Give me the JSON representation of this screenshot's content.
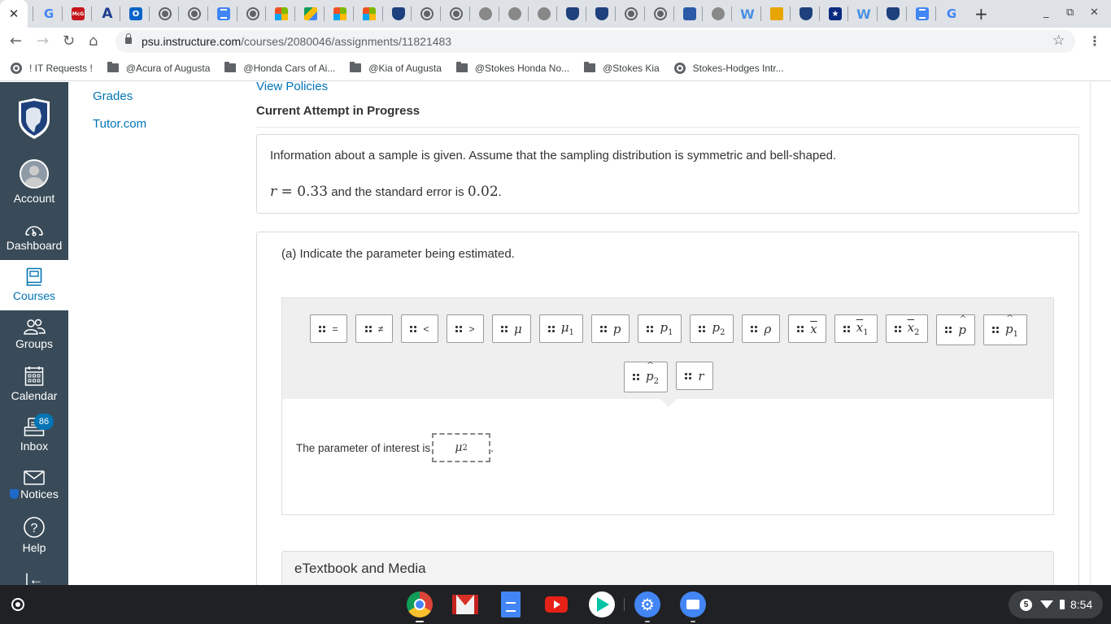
{
  "browser": {
    "active_tab_close": "✕",
    "pinned_tabs": [
      {
        "icon": "google-icon",
        "glyph": "G",
        "cls": "g"
      },
      {
        "icon": "mcgraw-hill-icon",
        "glyph": "McG",
        "cls": "mcg"
      },
      {
        "icon": "aleks-icon",
        "glyph": "A",
        "cls": "a"
      },
      {
        "icon": "outlook-icon",
        "glyph": "O",
        "cls": "outlook"
      },
      {
        "icon": "globe-icon",
        "glyph": "",
        "cls": "globe"
      },
      {
        "icon": "globe-icon",
        "glyph": "",
        "cls": "globe"
      },
      {
        "icon": "google-docs-icon",
        "glyph": "",
        "cls": "docs"
      },
      {
        "icon": "globe-icon",
        "glyph": "",
        "cls": "globe"
      },
      {
        "icon": "microsoft-icon",
        "glyph": "",
        "cls": "ms"
      },
      {
        "icon": "google-drive-icon",
        "glyph": "",
        "cls": "drive"
      },
      {
        "icon": "microsoft-icon",
        "glyph": "",
        "cls": "ms"
      },
      {
        "icon": "microsoft-icon",
        "glyph": "",
        "cls": "ms"
      },
      {
        "icon": "psu-shield-icon",
        "glyph": "",
        "cls": "psu"
      },
      {
        "icon": "globe-icon",
        "glyph": "",
        "cls": "globe"
      },
      {
        "icon": "globe-icon",
        "glyph": "",
        "cls": "globe"
      },
      {
        "icon": "seal-icon",
        "glyph": "",
        "cls": "seal"
      },
      {
        "icon": "seal-icon",
        "glyph": "",
        "cls": "seal"
      },
      {
        "icon": "seal-icon",
        "glyph": "",
        "cls": "seal"
      },
      {
        "icon": "psu-shield-icon",
        "glyph": "",
        "cls": "psu"
      },
      {
        "icon": "psu-shield-icon",
        "glyph": "",
        "cls": "psu"
      },
      {
        "icon": "globe-icon",
        "glyph": "",
        "cls": "globe"
      },
      {
        "icon": "globe-icon",
        "glyph": "",
        "cls": "globe"
      },
      {
        "icon": "irs-icon",
        "glyph": "",
        "cls": "irs"
      },
      {
        "icon": "seal-icon",
        "glyph": "",
        "cls": "seal"
      },
      {
        "icon": "word-icon",
        "glyph": "W",
        "cls": "w"
      },
      {
        "icon": "lock-icon",
        "glyph": "",
        "cls": "lock"
      },
      {
        "icon": "psu-shield-icon",
        "glyph": "",
        "cls": "psu"
      },
      {
        "icon": "star-shield-icon",
        "glyph": "★",
        "cls": "star"
      },
      {
        "icon": "word-icon",
        "glyph": "W",
        "cls": "w"
      },
      {
        "icon": "psu-shield-icon",
        "glyph": "",
        "cls": "psu"
      },
      {
        "icon": "google-docs-icon",
        "glyph": "",
        "cls": "docs"
      },
      {
        "icon": "google-icon",
        "glyph": "G",
        "cls": "g"
      }
    ],
    "new_tab": "+",
    "window_controls": {
      "minimize": "_",
      "restore": "⧉",
      "close": "✕"
    },
    "nav": {
      "back": "←",
      "forward": "→",
      "reload": "↻",
      "home": "⌂"
    },
    "url_host": "psu.instructure.com",
    "url_path": "/courses/2080046/assignments/11821483",
    "bookmark_star": "☆",
    "menu": "⋮",
    "bookmarks": [
      {
        "label": "! IT Requests !",
        "type": "globe"
      },
      {
        "label": "@Acura of Augusta",
        "type": "folder"
      },
      {
        "label": "@Honda Cars of Ai...",
        "type": "folder"
      },
      {
        "label": "@Kia of Augusta",
        "type": "folder"
      },
      {
        "label": "@Stokes Honda No...",
        "type": "folder"
      },
      {
        "label": "@Stokes Kia",
        "type": "folder"
      },
      {
        "label": "Stokes-Hodges Intr...",
        "type": "globe"
      }
    ]
  },
  "global_nav": {
    "items": [
      {
        "label": "Account",
        "icon": "avatar"
      },
      {
        "label": "Dashboard",
        "icon": "dashboard-icon"
      },
      {
        "label": "Courses",
        "icon": "courses-icon",
        "active": true
      },
      {
        "label": "Groups",
        "icon": "groups-icon"
      },
      {
        "label": "Calendar",
        "icon": "calendar-icon"
      },
      {
        "label": "Inbox",
        "icon": "inbox-icon",
        "badge": "86"
      },
      {
        "label": "Notices",
        "icon": "notices-icon"
      },
      {
        "label": "Help",
        "icon": "help-icon"
      }
    ],
    "collapse": "|←"
  },
  "course_nav": {
    "items": [
      "Grades",
      "Tutor.com"
    ]
  },
  "main": {
    "view_policies": "View Policies",
    "attempt_heading": "Current Attempt in Progress",
    "info_text": "Information about a sample is given. Assume that the sampling distribution is symmetric and bell-shaped.",
    "info_eq": {
      "var": "r",
      "eq": " = 0.33",
      "mid": " and the standard error is ",
      "se": "0.02",
      "end": "."
    },
    "part_a": "(a) Indicate the parameter being estimated.",
    "tiles": [
      {
        "base": "=",
        "sub": "",
        "type": "op"
      },
      {
        "base": "≠",
        "sub": "",
        "type": "op"
      },
      {
        "base": "<",
        "sub": "",
        "type": "op"
      },
      {
        "base": ">",
        "sub": "",
        "type": "op"
      },
      {
        "base": "μ",
        "sub": "",
        "type": "plain"
      },
      {
        "base": "μ",
        "sub": "1",
        "type": "plain"
      },
      {
        "base": "p",
        "sub": "",
        "type": "plain"
      },
      {
        "base": "p",
        "sub": "1",
        "type": "plain"
      },
      {
        "base": "p",
        "sub": "2",
        "type": "plain"
      },
      {
        "base": "ρ",
        "sub": "",
        "type": "plain"
      },
      {
        "base": "x",
        "sub": "",
        "type": "bar"
      },
      {
        "base": "x",
        "sub": "1",
        "type": "bar"
      },
      {
        "base": "x",
        "sub": "2",
        "type": "bar"
      },
      {
        "base": "p",
        "sub": "",
        "type": "hat"
      },
      {
        "base": "p",
        "sub": "1",
        "type": "hat"
      },
      {
        "base": "p",
        "sub": "2",
        "type": "hat"
      },
      {
        "base": "r",
        "sub": "",
        "type": "plain"
      }
    ],
    "sentence": "The parameter of interest is",
    "answer": {
      "base": "μ",
      "sub": "2"
    },
    "sentence_end": ".",
    "etextbook": "eTextbook and Media"
  },
  "shelf": {
    "apps": [
      {
        "name": "chrome",
        "icon": "chrome-icon"
      },
      {
        "name": "gmail",
        "icon": "gmail-icon"
      },
      {
        "name": "docs",
        "icon": "google-docs-icon"
      },
      {
        "name": "youtube",
        "icon": "youtube-icon"
      },
      {
        "name": "play-store",
        "icon": "play-store-icon"
      },
      {
        "name": "settings",
        "icon": "settings-icon"
      },
      {
        "name": "files",
        "icon": "files-icon"
      }
    ],
    "notification_count": "5",
    "time": "8:54"
  },
  "colors": {
    "canvas_nav_bg": "#394b58",
    "link_blue": "#0374b5",
    "tray_bg": "#efefef"
  }
}
